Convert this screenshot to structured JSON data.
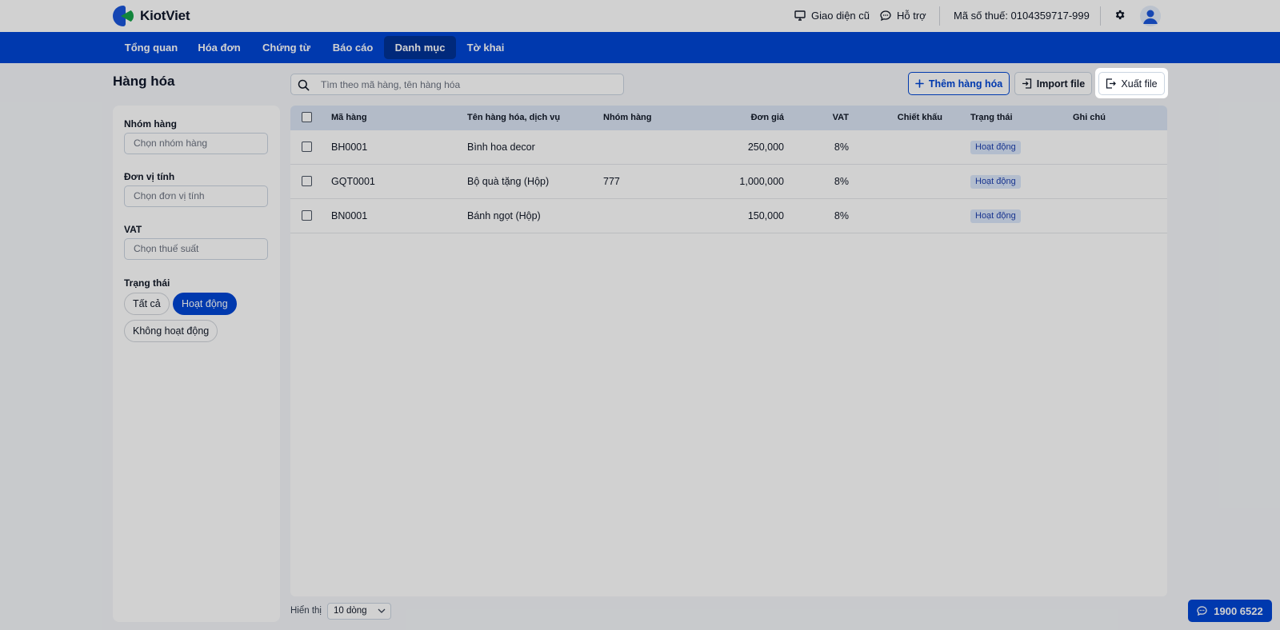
{
  "brand": {
    "name": "KiotViet"
  },
  "topbar": {
    "old_ui_label": "Giao diện cũ",
    "support_label": "Hỗ trợ",
    "tax_code": "Mã số thuế: 0104359717-999",
    "settings_icon": "gear-icon",
    "avatar_icon": "user-avatar-icon"
  },
  "nav": {
    "items": [
      {
        "label": "Tổng quan"
      },
      {
        "label": "Hóa đơn"
      },
      {
        "label": "Chứng từ"
      },
      {
        "label": "Báo cáo"
      },
      {
        "label": "Danh mục",
        "active": true
      },
      {
        "label": "Tờ khai"
      }
    ]
  },
  "page": {
    "title": "Hàng hóa"
  },
  "filters": {
    "group": {
      "label": "Nhóm hàng",
      "placeholder": "Chọn nhóm hàng"
    },
    "unit": {
      "label": "Đơn vị tính",
      "placeholder": "Chọn đơn vị tính"
    },
    "vat": {
      "label": "VAT",
      "placeholder": "Chọn thuế suất"
    },
    "status": {
      "label": "Trạng thái",
      "options": [
        "Tất cả",
        "Hoạt động",
        "Không hoạt động"
      ],
      "selected": "Hoạt động"
    }
  },
  "search": {
    "placeholder": "Tìm theo mã hàng, tên hàng hóa"
  },
  "actions": {
    "add_label": "Thêm hàng hóa",
    "import_label": "Import file",
    "export_label": "Xuất file"
  },
  "table": {
    "columns": [
      "Mã hàng",
      "Tên hàng hóa, dịch vụ",
      "Nhóm hàng",
      "Đơn giá",
      "VAT",
      "Chiết khấu",
      "Trạng thái",
      "Ghi chú"
    ],
    "rows": [
      {
        "code": "BH0001",
        "name": "Bình hoa decor",
        "group": "",
        "price": "250,000",
        "vat": "8%",
        "discount": "",
        "status": "Hoạt động",
        "note": ""
      },
      {
        "code": "GQT0001",
        "name": "Bộ quà tặng (Hộp)",
        "group": "777",
        "price": "1,000,000",
        "vat": "8%",
        "discount": "",
        "status": "Hoạt động",
        "note": ""
      },
      {
        "code": "BN0001",
        "name": "Bánh ngọt (Hộp)",
        "group": "",
        "price": "150,000",
        "vat": "8%",
        "discount": "",
        "status": "Hoạt động",
        "note": ""
      }
    ]
  },
  "footer": {
    "show_label": "Hiển thị",
    "rows_per_page": "10 dòng"
  },
  "hotline": {
    "number": "1900 6522"
  },
  "colors": {
    "primary": "#0046d5",
    "nav_active": "#003296",
    "badge_bg": "#dbe7fb",
    "badge_text": "#1e40af"
  }
}
